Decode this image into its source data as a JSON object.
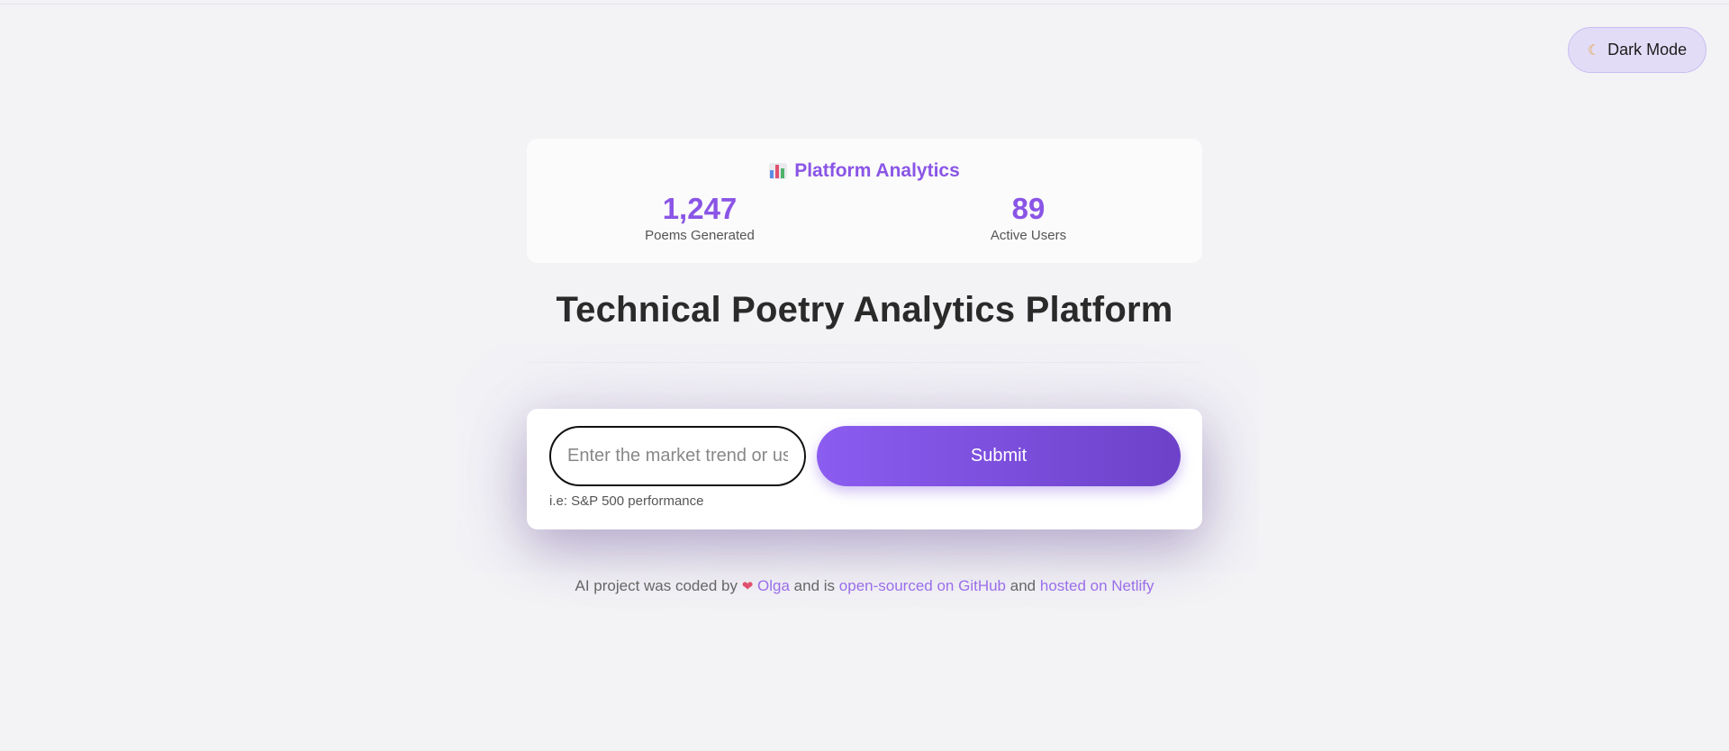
{
  "header": {
    "dark_mode_label": "Dark Mode",
    "dark_mode_icon": "moon-icon"
  },
  "analytics": {
    "title": "Platform Analytics",
    "icon": "bar-chart-icon",
    "stats": [
      {
        "value": "1,247",
        "label": "Poems Generated"
      },
      {
        "value": "89",
        "label": "Active Users"
      }
    ]
  },
  "main": {
    "title": "Technical Poetry Analytics Platform"
  },
  "form": {
    "input_placeholder": "Enter the market trend or use",
    "input_value": "",
    "submit_label": "Submit",
    "hint": "i.e: S&P 500 performance"
  },
  "footer": {
    "prefix": "AI project was coded by",
    "heart_icon": "heart-icon",
    "author_link": "Olga",
    "middle_1": "and is",
    "github_link": "open-sourced on GitHub",
    "middle_2": "and",
    "netlify_link": "hosted on Netlify"
  },
  "colors": {
    "accent": "#8a55e6",
    "button_start": "#8b5cf0",
    "button_end": "#6d42c9",
    "background": "#f3f3f6"
  }
}
